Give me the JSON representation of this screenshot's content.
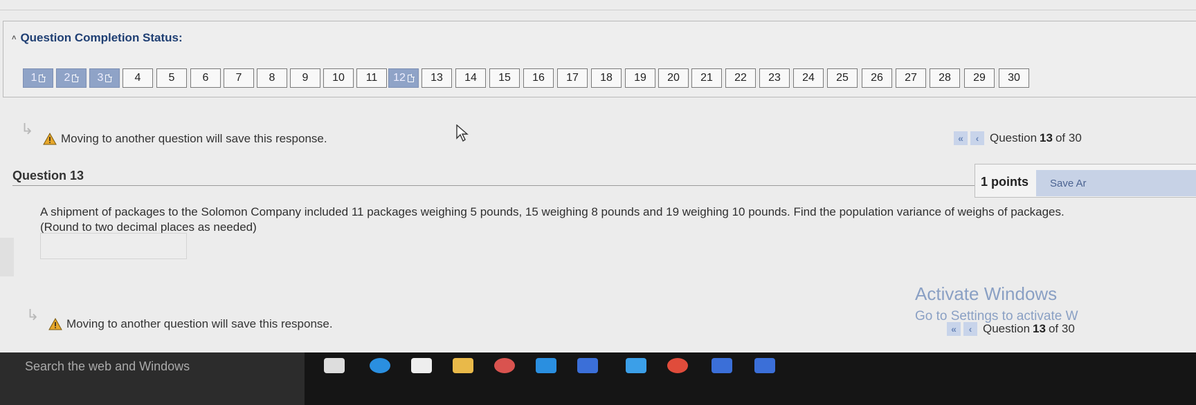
{
  "status": {
    "title": "Question Completion Status:",
    "buttons": [
      {
        "label": "1",
        "answered": true
      },
      {
        "label": "2",
        "answered": true
      },
      {
        "label": "3",
        "answered": true
      },
      {
        "label": "4",
        "answered": false
      },
      {
        "label": "5",
        "answered": false
      },
      {
        "label": "6",
        "answered": false
      },
      {
        "label": "7",
        "answered": false
      },
      {
        "label": "8",
        "answered": false
      },
      {
        "label": "9",
        "answered": false
      },
      {
        "label": "10",
        "answered": false
      },
      {
        "label": "11",
        "answered": false
      },
      {
        "label": "12",
        "answered": true
      },
      {
        "label": "13",
        "answered": false
      },
      {
        "label": "14",
        "answered": false
      },
      {
        "label": "15",
        "answered": false
      },
      {
        "label": "16",
        "answered": false
      },
      {
        "label": "17",
        "answered": false
      },
      {
        "label": "18",
        "answered": false
      },
      {
        "label": "19",
        "answered": false
      },
      {
        "label": "20",
        "answered": false
      },
      {
        "label": "21",
        "answered": false
      },
      {
        "label": "22",
        "answered": false
      },
      {
        "label": "23",
        "answered": false
      },
      {
        "label": "24",
        "answered": false
      },
      {
        "label": "25",
        "answered": false
      },
      {
        "label": "26",
        "answered": false
      },
      {
        "label": "27",
        "answered": false
      },
      {
        "label": "28",
        "answered": false
      },
      {
        "label": "29",
        "answered": false
      },
      {
        "label": "30",
        "answered": false
      }
    ]
  },
  "warning": {
    "text": "Moving to another question will save this response."
  },
  "counter": {
    "prefix": "Question",
    "current": "13",
    "suffix": "of 30",
    "first_icon": "«",
    "prev_icon": "‹"
  },
  "question": {
    "title": "Question 13",
    "points": "1 points",
    "save_label": "Save Ar",
    "text": "A shipment of packages to the Solomon Company included 11 packages weighing 5 pounds, 15 weighing 8 pounds and 19 weighing 10 pounds. Find the population variance of weighs of packages.",
    "hint": "(Round to two decimal places as needed)",
    "answer_value": ""
  },
  "watermark": {
    "title": "Activate Windows",
    "subtitle": "Go to Settings to activate W"
  },
  "taskbar": {
    "search_placeholder": "Search the web and Windows"
  },
  "colors": {
    "title_blue": "#1f3f73",
    "answered_bg": "#8fa3c7",
    "warning_yellow": "#e7a72a"
  }
}
